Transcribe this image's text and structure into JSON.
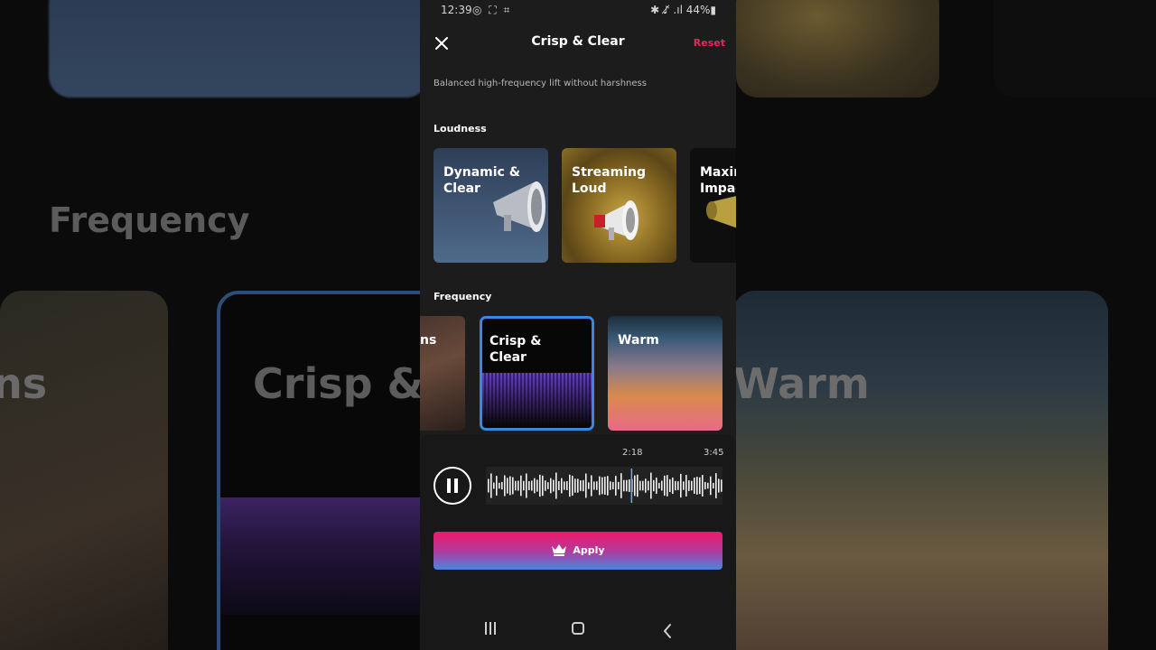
{
  "background": {
    "frequency_label": "Frequency",
    "tile_left_text": "ns",
    "tile_mid_text": "Crisp &",
    "tile_right_text": "Warm"
  },
  "status": {
    "time": "12:39",
    "left_icons": "◎ ⛶ ⌗",
    "right": "✱ ♪̸ .ıl 44%▮"
  },
  "header": {
    "title": "Crisp & Clear",
    "reset_label": "Reset"
  },
  "description": "Balanced high-frequency lift without harshness",
  "loudness": {
    "label": "Loudness",
    "presets": [
      {
        "label": "Dynamic & Clear"
      },
      {
        "label": "Streaming Loud"
      },
      {
        "label": "Maxim Impac"
      }
    ]
  },
  "frequency": {
    "label": "Frequency",
    "presets": [
      {
        "label": "ns"
      },
      {
        "label": "Crisp & Clear",
        "selected": true
      },
      {
        "label": "Warm"
      }
    ]
  },
  "player": {
    "current_time": "2:18",
    "total_time": "3:45",
    "progress": 0.613
  },
  "apply": {
    "label": "Apply",
    "icon": "crown-icon"
  },
  "colors": {
    "accent": "#e8265e",
    "selected_border": "#3a86e0"
  }
}
